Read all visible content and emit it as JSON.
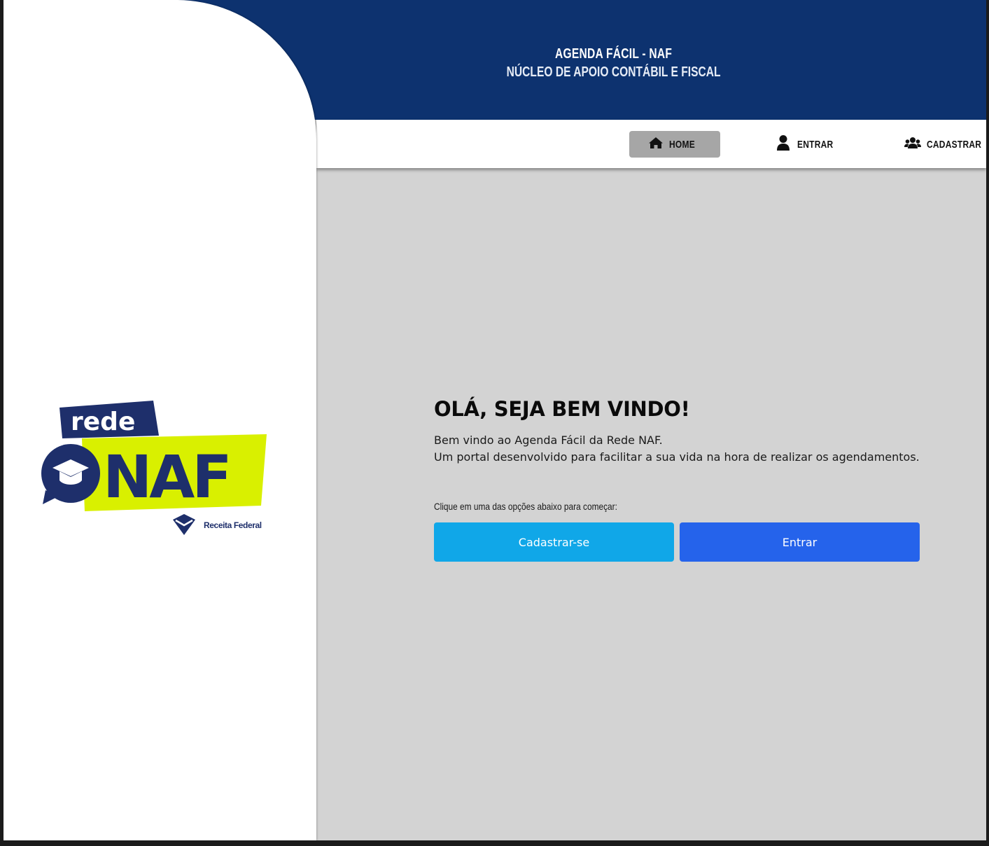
{
  "header": {
    "title": "AGENDA FÁCIL - NAF",
    "subtitle": "NÚCLEO DE APOIO CONTÁBIL E FISCAL"
  },
  "nav": {
    "items": [
      {
        "label": "HOME",
        "icon": "home-icon",
        "active": true
      },
      {
        "label": "ENTRAR",
        "icon": "user-icon",
        "active": false
      },
      {
        "label": "CADASTRAR",
        "icon": "users-icon",
        "active": false
      }
    ]
  },
  "logo": {
    "top_word": "rede",
    "main_word": "NAF",
    "partner": "Receita Federal"
  },
  "main": {
    "title": "OLÁ, SEJA BEM VINDO!",
    "line1": "Bem vindo ao Agenda Fácil da Rede NAF.",
    "line2": "Um portal desenvolvido para facilitar a sua vida na hora de realizar os agendamentos.",
    "hint": "Clique em uma das opções abaixo para começar:",
    "signup_label": "Cadastrar-se",
    "login_label": "Entrar"
  },
  "colors": {
    "header_bg": "#0d326f",
    "content_bg": "#d3d3d3",
    "signup_button": "#10a7e8",
    "login_button": "#2563eb",
    "logo_navy": "#1e2f6b",
    "logo_lime": "#d9f000"
  }
}
